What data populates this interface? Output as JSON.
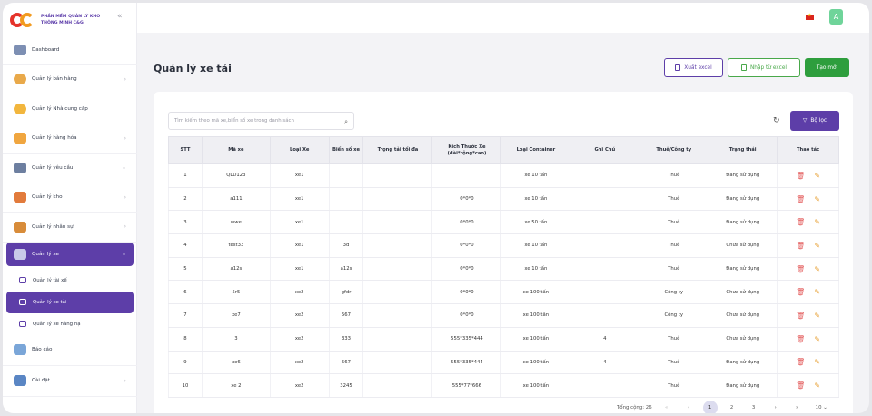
{
  "brand": {
    "line1": "PHẦN MỀM QUẢN LÝ KHO",
    "line2": "THÔNG MINH C&G"
  },
  "sidebar": {
    "items": [
      {
        "label": "Dashboard",
        "icon": "dashboard-icon",
        "color": "#7d8fb3"
      },
      {
        "label": "Quản lý bán hàng",
        "icon": "user-icon",
        "color": "#e9a94a"
      },
      {
        "label": "Quản lý Nhà cung cấp",
        "icon": "supplier-icon",
        "color": "#f2b63d"
      },
      {
        "label": "Quản lý hàng hóa",
        "icon": "goods-icon",
        "color": "#f0a640"
      },
      {
        "label": "Quản lý yêu cầu",
        "icon": "request-icon",
        "color": "#6d7fa0"
      },
      {
        "label": "Quản lý kho",
        "icon": "warehouse-icon",
        "color": "#e27b3c"
      },
      {
        "label": "Quản lý nhân sự",
        "icon": "staff-icon",
        "color": "#d88c3a"
      },
      {
        "label": "Quản lý xe",
        "icon": "vehicle-icon",
        "color": "#c9c9e8"
      }
    ],
    "sub_items": [
      {
        "label": "Quản lý tài xế"
      },
      {
        "label": "Quản lý xe tải"
      },
      {
        "label": "Quản lý xe nâng hạ"
      }
    ],
    "bottom_items": [
      {
        "label": "Báo cáo",
        "icon": "report-icon",
        "color": "#7aa6d8"
      },
      {
        "label": "Cài đặt",
        "icon": "settings-icon",
        "color": "#5a86c4"
      }
    ]
  },
  "topbar": {
    "avatar": "A"
  },
  "page": {
    "title": "Quản lý xe tải"
  },
  "buttons": {
    "export": "Xuất excel",
    "import": "Nhập từ excel",
    "create": "Tạo mới",
    "filter": "Bộ lọc"
  },
  "search": {
    "placeholder": "Tìm kiếm theo mã xe,biển số xe trong danh sách"
  },
  "table": {
    "headers": [
      "STT",
      "Mã xe",
      "Loại Xe",
      "Biển số xe",
      "Trọng tải tối đa",
      "Kích Thước Xe (dài*rộng*cao)",
      "Loại Container",
      "Ghi Chú",
      "Thuê/Công ty",
      "Trạng thái",
      "Thao tác"
    ],
    "rows": [
      [
        "1",
        "QLD123",
        "xe1",
        "",
        "",
        "",
        "xe 10 tấn",
        "",
        "Thuê",
        "Đang sử dụng"
      ],
      [
        "2",
        "a111",
        "xe1",
        "",
        "",
        "0*0*0",
        "xe 10 tấn",
        "",
        "Thuê",
        "Đang sử dụng"
      ],
      [
        "3",
        "wwe",
        "xe1",
        "",
        "",
        "0*0*0",
        "xe 50 tấn",
        "",
        "Thuê",
        "Đang sử dụng"
      ],
      [
        "4",
        "test33",
        "xe1",
        "3d",
        "",
        "0*0*0",
        "xe 10 tấn",
        "",
        "Thuê",
        "Chưa sử dụng"
      ],
      [
        "5",
        "a12s",
        "xe1",
        "a12s",
        "",
        "0*0*0",
        "xe 10 tấn",
        "",
        "Thuê",
        "Đang sử dụng"
      ],
      [
        "6",
        "5r5",
        "xe2",
        "gfdr",
        "",
        "0*0*0",
        "xe 100 tấn",
        "",
        "Công ty",
        "Chưa sử dụng"
      ],
      [
        "7",
        "xe7",
        "xe2",
        "567",
        "",
        "0*0*0",
        "xe 100 tấn",
        "",
        "Công ty",
        "Chưa sử dụng"
      ],
      [
        "8",
        "3",
        "xe2",
        "333",
        "",
        "555*335*444",
        "xe 100 tấn",
        "4",
        "Thuê",
        "Chưa sử dụng"
      ],
      [
        "9",
        "xe6",
        "xe2",
        "567",
        "",
        "555*335*444",
        "xe 100 tấn",
        "4",
        "Thuê",
        "Đang sử dụng"
      ],
      [
        "10",
        "xe 2",
        "xe2",
        "3245",
        "",
        "555*77*666",
        "xe 100 tấn",
        "",
        "Thuê",
        "Đang sử dụng"
      ]
    ]
  },
  "pagination": {
    "total": "Tổng cộng: 26",
    "pages": [
      "1",
      "2",
      "3"
    ],
    "current": "1",
    "page_size": "10"
  },
  "colors": {
    "primary": "#5d3ea8",
    "success": "#2e9e3d",
    "danger": "#e35a5a",
    "warning": "#e8a33a"
  }
}
